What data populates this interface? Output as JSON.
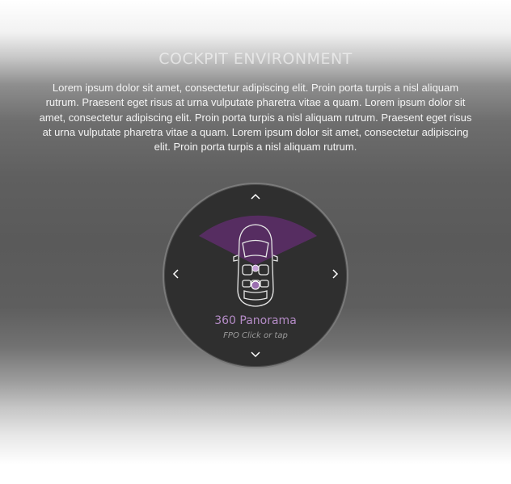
{
  "header": {
    "title": "COCKPIT ENVIRONMENT",
    "description": "Lorem ipsum dolor sit amet, consectetur adipiscing elit. Proin porta turpis a nisl aliquam rutrum. Praesent eget risus at urna vulputate pharetra vitae a quam. Lorem ipsum dolor sit amet, consectetur adipiscing elit. Proin porta turpis a nisl aliquam rutrum. Praesent eget risus at urna vulputate pharetra vitae a quam. Lorem ipsum dolor sit amet, consectetur adipiscing elit. Proin porta turpis a nisl aliquam rutrum."
  },
  "dial": {
    "mode_label": "360 Panorama",
    "hint": "FPO Click or tap",
    "icons": {
      "up": "chevron-up-icon",
      "down": "chevron-down-icon",
      "left": "chevron-left-icon",
      "right": "chevron-right-icon",
      "vehicle": "car-top-view-icon"
    },
    "colors": {
      "accent": "#b58cc7",
      "fov_fill": "#5b2e67",
      "dial_bg": "#2f2f2f",
      "dial_border": "#7a7a7a"
    }
  }
}
